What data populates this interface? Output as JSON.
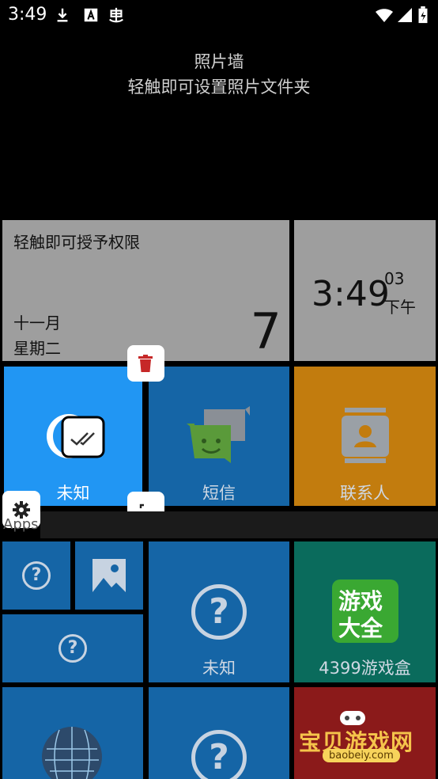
{
  "status_bar": {
    "time": "3:49",
    "icons": [
      "download-icon",
      "a-icon",
      "bug-icon",
      "wifi-icon",
      "signal-icon",
      "battery-icon"
    ]
  },
  "photo_wall": {
    "title": "照片墙",
    "subtitle": "轻触即可设置照片文件夹"
  },
  "calendar_tile": {
    "permission_text": "轻触即可授予权限",
    "month": "十一月",
    "weekday": "星期二",
    "day": "7"
  },
  "clock_tile": {
    "time": "3:49",
    "seconds": "03",
    "ampm": "下午"
  },
  "tiles": {
    "selected_label": "未知",
    "sms_label": "短信",
    "contacts_label": "联系人",
    "unknown_label": "未知",
    "game_label": "4399游戏盒",
    "game_icon_text_1": "游戏",
    "game_icon_text_2": "大全"
  },
  "section": {
    "apps_label": "Apps"
  },
  "watermark": {
    "text": "宝贝游戏网",
    "url": "baobeiy.com"
  },
  "colors": {
    "accent_blue": "#2196f3",
    "tile_blue": "#1565a6",
    "tile_orange": "#c27c0e",
    "tile_grey": "#9e9e9e",
    "tile_green": "#0a6b5c",
    "delete_red": "#c62828"
  }
}
